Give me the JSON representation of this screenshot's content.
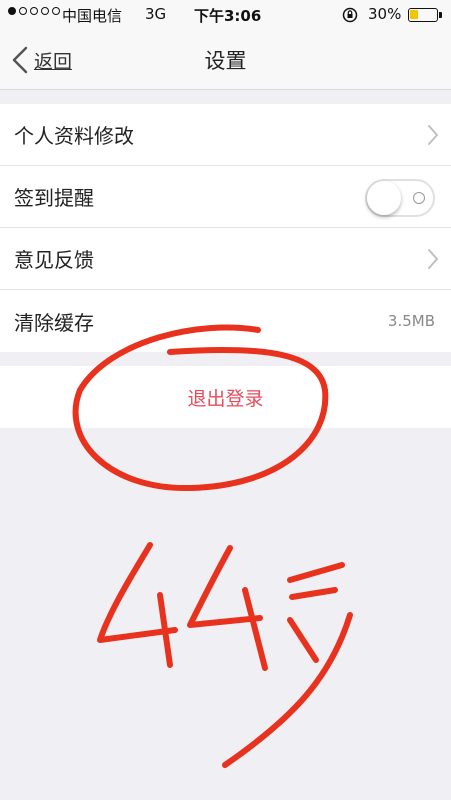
{
  "status_bar": {
    "carrier": "中国电信",
    "network": "3G",
    "time": "下午3:06",
    "battery": "30%",
    "battery_level": 0.3
  },
  "nav": {
    "back_label": "返回",
    "title": "设置"
  },
  "settings": {
    "profile_label": "个人资料修改",
    "checkin_reminder_label": "签到提醒",
    "checkin_reminder_on": false,
    "feedback_label": "意见反馈",
    "clear_cache_label": "清除缓存",
    "cache_size": "3.5MB"
  },
  "logout": {
    "label": "退出登录"
  },
  "annotation": {
    "color": "#e8321e"
  },
  "colors": {
    "nav_bg": "#f8f8f8",
    "page_bg": "#efeff4",
    "logout_text": "#e74c5c",
    "battery_fill": "#f5c400"
  }
}
